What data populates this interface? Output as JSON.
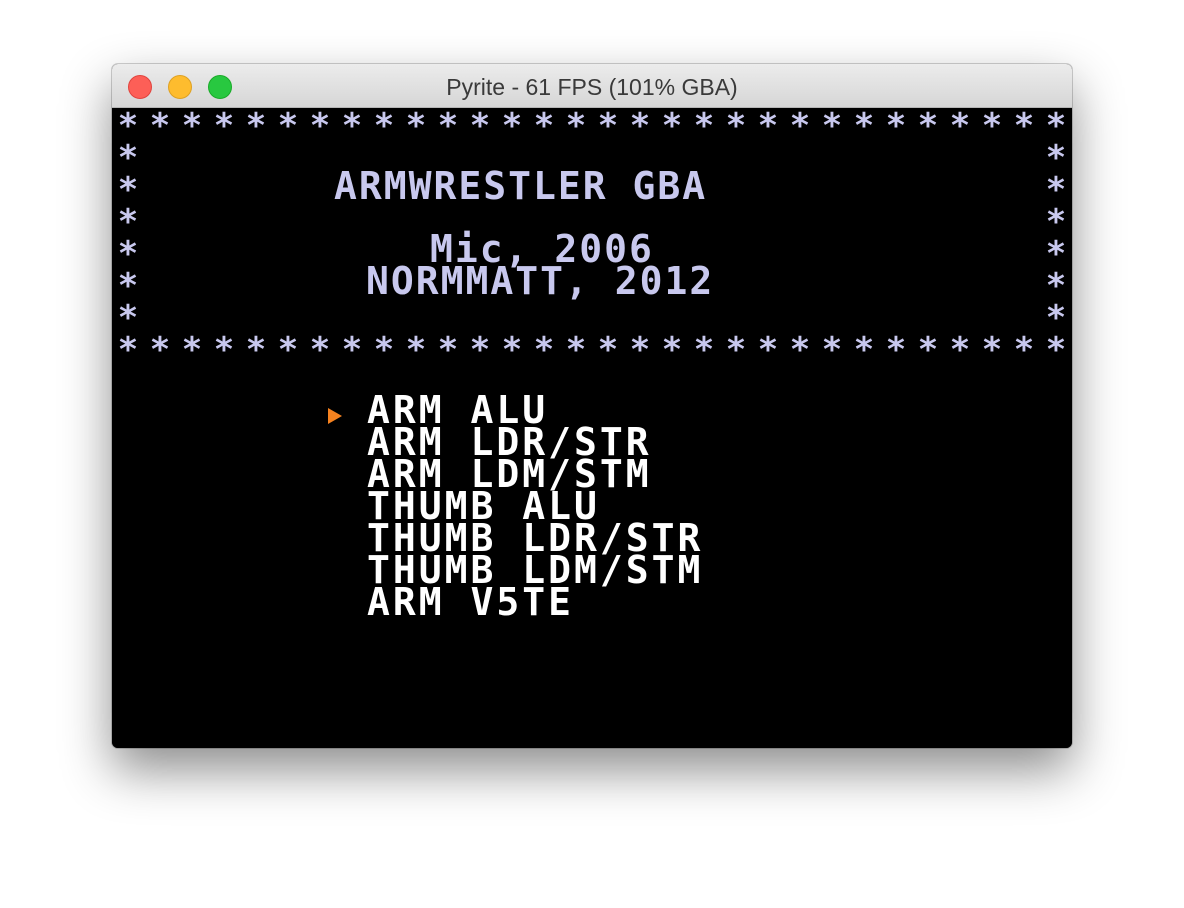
{
  "window": {
    "title": "Pyrite - 61 FPS (101% GBA)"
  },
  "screen": {
    "border_char": "*",
    "header": {
      "title": "ARMWRESTLER GBA",
      "credit1": "Mic, 2006",
      "credit2": "NORMMATT, 2012"
    },
    "menu": {
      "selected_index": 0,
      "cursor_color": "#f6821f",
      "items": [
        "ARM ALU",
        "ARM LDR/STR",
        "ARM LDM/STM",
        "THUMB ALU",
        "THUMB LDR/STR",
        "THUMB LDM/STM",
        "ARM V5TE"
      ]
    },
    "colors": {
      "border": "#c8c8ee",
      "header_text": "#c8c8ee",
      "menu_text": "#ffffff",
      "background": "#000000"
    }
  }
}
